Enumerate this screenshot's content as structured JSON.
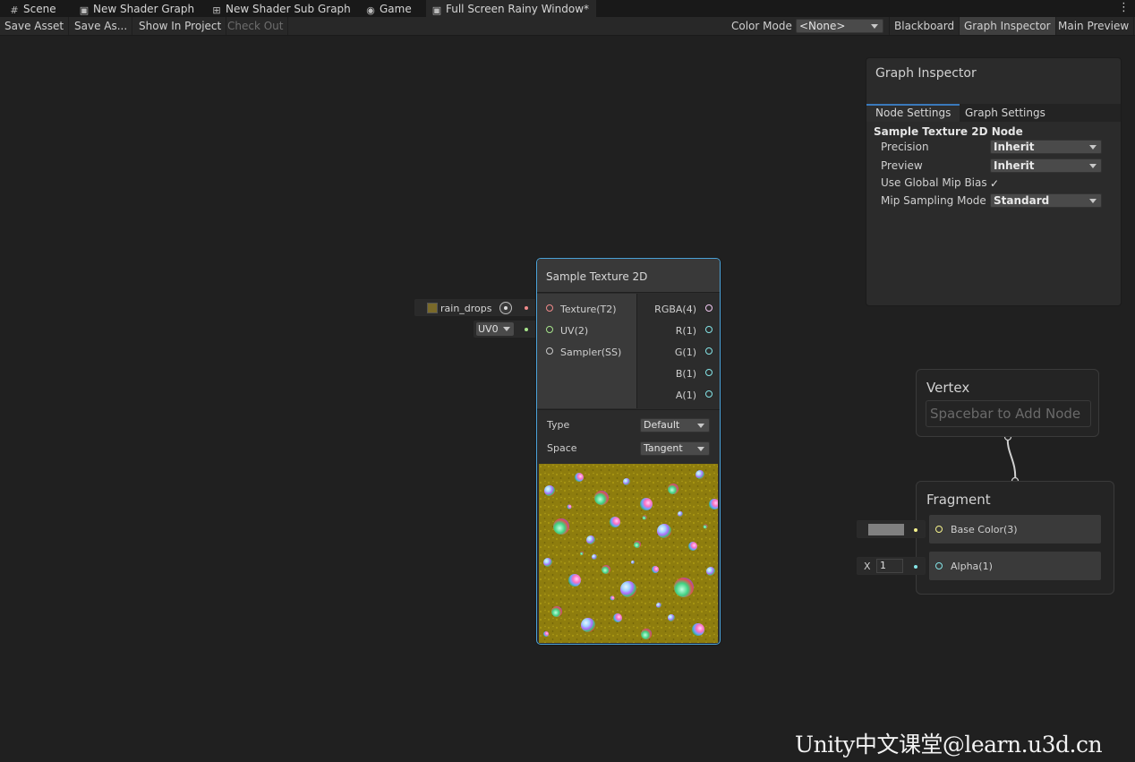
{
  "tabs": [
    {
      "label": "Scene",
      "icon": "grid-icon"
    },
    {
      "label": "New Shader Graph",
      "icon": "shader-graph-icon"
    },
    {
      "label": "New Shader Sub Graph",
      "icon": "sub-graph-icon"
    },
    {
      "label": "Game",
      "icon": "gamepad-icon"
    },
    {
      "label": "Full Screen Rainy Window*",
      "icon": "shader-graph-icon"
    }
  ],
  "toolbar": {
    "save_asset": "Save Asset",
    "save_as": "Save As...",
    "show_in_project": "Show In Project",
    "check_out": "Check Out",
    "color_mode_label": "Color Mode",
    "color_mode_value": "<None>",
    "blackboard": "Blackboard",
    "graph_inspector": "Graph Inspector",
    "main_preview": "Main Preview"
  },
  "inspector": {
    "title": "Graph Inspector",
    "tabs": [
      "Node Settings",
      "Graph Settings"
    ],
    "node_title": "Sample Texture 2D Node",
    "properties": [
      {
        "label": "Precision",
        "value": "Inherit"
      },
      {
        "label": "Preview",
        "value": "Inherit"
      },
      {
        "label": "Use Global Mip Bias",
        "value": "✓"
      },
      {
        "label": "Mip Sampling Mode",
        "value": "Standard"
      }
    ]
  },
  "sample_node": {
    "title": "Sample Texture 2D",
    "inputs": [
      "Texture(T2)",
      "UV(2)",
      "Sampler(SS)"
    ],
    "outputs": [
      "RGBA(4)",
      "R(1)",
      "G(1)",
      "B(1)",
      "A(1)"
    ],
    "type_label": "Type",
    "type_value": "Default",
    "space_label": "Space",
    "space_value": "Tangent",
    "texture_input": "rain_drops",
    "uv_input": "UV0"
  },
  "vertex": {
    "title": "Vertex",
    "hint": "Spacebar to Add Node"
  },
  "fragment": {
    "title": "Fragment",
    "blocks": [
      "Base Color(3)",
      "Alpha(1)"
    ],
    "alpha_axis": "X",
    "alpha_value": "1"
  },
  "colors": {
    "background": "#202020",
    "selection_outline": "#4ba3d9",
    "texture_port": "#f08a8a",
    "uv_port": "#a6e38a",
    "vector3_port": "#f5f28c",
    "float_port": "#84e4e7",
    "rgba_port": "#f2c9f2"
  },
  "watermark": "Unity中文课堂@learn.u3d.cn"
}
